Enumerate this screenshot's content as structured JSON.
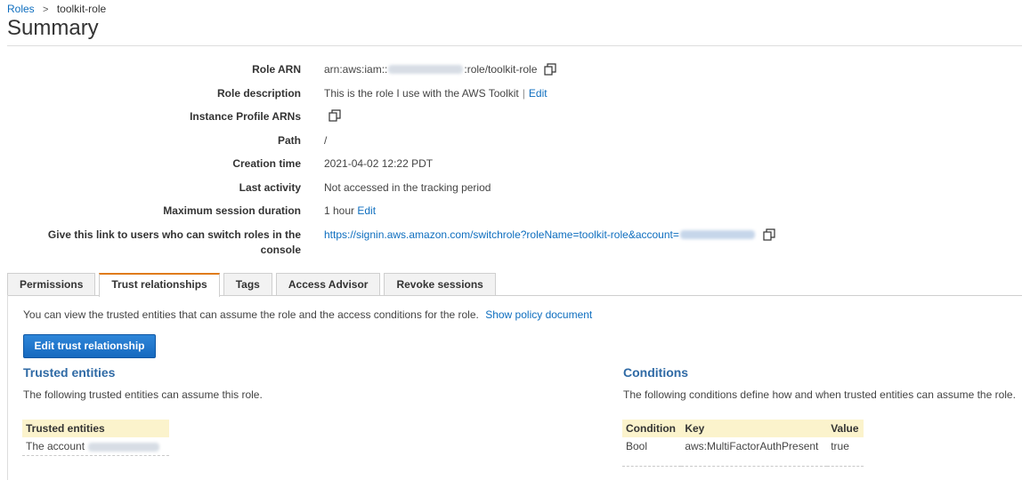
{
  "breadcrumb": {
    "parent": "Roles",
    "separator": ">",
    "current": "toolkit-role"
  },
  "page_title": "Summary",
  "summary": {
    "role_arn": {
      "label": "Role ARN",
      "prefix": "arn:aws:iam::",
      "suffix": ":role/toolkit-role",
      "copy_icon": "copy-icon"
    },
    "role_description": {
      "label": "Role description",
      "value": "This is the role I use with the AWS Toolkit",
      "separator": "|",
      "edit": "Edit"
    },
    "instance_profile": {
      "label": "Instance Profile ARNs",
      "copy_icon": "copy-icon"
    },
    "path": {
      "label": "Path",
      "value": "/"
    },
    "creation_time": {
      "label": "Creation time",
      "value": "2021-04-02 12:22 PDT"
    },
    "last_activity": {
      "label": "Last activity",
      "value": "Not accessed in the tracking period"
    },
    "max_session": {
      "label": "Maximum session duration",
      "value": "1 hour",
      "edit": "Edit"
    },
    "switch_link": {
      "label_line1": "Give this link to users who can switch roles in the",
      "label_line2": "console",
      "value": "https://signin.aws.amazon.com/switchrole?roleName=toolkit-role&account=",
      "copy_icon": "copy-icon"
    }
  },
  "tabs": [
    {
      "label": "Permissions",
      "active": false
    },
    {
      "label": "Trust relationships",
      "active": true
    },
    {
      "label": "Tags",
      "active": false
    },
    {
      "label": "Access Advisor",
      "active": false
    },
    {
      "label": "Revoke sessions",
      "active": false
    }
  ],
  "trust": {
    "intro": "You can view the trusted entities that can assume the role and the access conditions for the role.",
    "show_policy_link": "Show policy document",
    "edit_button": "Edit trust relationship",
    "trusted_entities": {
      "title": "Trusted entities",
      "description": "The following trusted entities can assume this role.",
      "table_header": "Trusted entities",
      "rows": [
        {
          "value": "The account"
        }
      ]
    },
    "conditions": {
      "title": "Conditions",
      "description": "The following conditions define how and when trusted entities can assume the role.",
      "headers": {
        "condition": "Condition",
        "key": "Key",
        "value": "Value"
      },
      "rows": [
        {
          "condition": "Bool",
          "key": "aws:MultiFactorAuthPresent",
          "value": "true"
        }
      ]
    }
  },
  "colors": {
    "link": "#0e6ebf",
    "tab_active_accent": "#e07b19",
    "primary_button": "#1669bf",
    "section_title": "#2f6aa5",
    "table_header_bg": "#fbf3cc"
  }
}
